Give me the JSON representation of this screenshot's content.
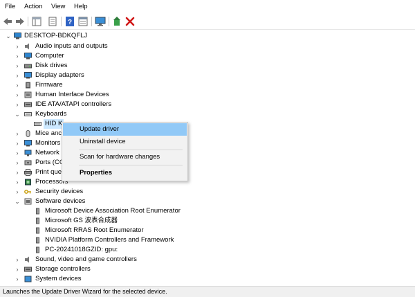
{
  "menu": [
    "File",
    "Action",
    "View",
    "Help"
  ],
  "toolbar_icons": [
    "back-icon",
    "forward-icon",
    "show-hide-tree-icon",
    "properties-icon",
    "help-icon",
    "view-icon",
    "monitor-icon",
    "update-driver-icon",
    "uninstall-icon"
  ],
  "tree": {
    "root": "DESKTOP-BDKQFLJ",
    "items": [
      {
        "label": "Audio inputs and outputs",
        "icon": "speaker-icon",
        "state": "collapsed"
      },
      {
        "label": "Computer",
        "icon": "computer-icon",
        "state": "collapsed"
      },
      {
        "label": "Disk drives",
        "icon": "disk-icon",
        "state": "collapsed"
      },
      {
        "label": "Display adapters",
        "icon": "display-icon",
        "state": "collapsed"
      },
      {
        "label": "Firmware",
        "icon": "chip-icon",
        "state": "collapsed"
      },
      {
        "label": "Human Interface Devices",
        "icon": "hid-icon",
        "state": "collapsed"
      },
      {
        "label": "IDE ATA/ATAPI controllers",
        "icon": "ide-icon",
        "state": "collapsed"
      },
      {
        "label": "Keyboards",
        "icon": "keyboard-icon",
        "state": "expanded"
      },
      {
        "label": "HID K",
        "icon": "keyboard-icon",
        "state": "child-selected"
      },
      {
        "label": "Mice anc",
        "icon": "mouse-icon",
        "state": "collapsed"
      },
      {
        "label": "Monitors",
        "icon": "monitor-icon",
        "state": "collapsed"
      },
      {
        "label": "Network",
        "icon": "network-icon",
        "state": "collapsed"
      },
      {
        "label": "Ports (CC",
        "icon": "port-icon",
        "state": "collapsed"
      },
      {
        "label": "Print que",
        "icon": "printer-icon",
        "state": "collapsed"
      },
      {
        "label": "Processors",
        "icon": "cpu-icon",
        "state": "collapsed"
      },
      {
        "label": "Security devices",
        "icon": "key-icon",
        "state": "collapsed"
      },
      {
        "label": "Software devices",
        "icon": "software-icon",
        "state": "expanded"
      },
      {
        "label": "Microsoft Device Association Root Enumerator",
        "icon": "device-icon",
        "state": "child"
      },
      {
        "label": "Microsoft GS 波表合成器",
        "icon": "device-icon",
        "state": "child"
      },
      {
        "label": "Microsoft RRAS Root Enumerator",
        "icon": "device-icon",
        "state": "child"
      },
      {
        "label": "NVIDIA Platform Controllers and Framework",
        "icon": "device-icon",
        "state": "child"
      },
      {
        "label": "PC-20241018GZID: gpu:",
        "icon": "device-icon",
        "state": "child"
      },
      {
        "label": "Sound, video and game controllers",
        "icon": "sound-icon",
        "state": "collapsed"
      },
      {
        "label": "Storage controllers",
        "icon": "storage-icon",
        "state": "collapsed"
      },
      {
        "label": "System devices",
        "icon": "system-icon",
        "state": "collapsed"
      }
    ]
  },
  "context_menu": {
    "update": "Update driver",
    "uninstall": "Uninstall device",
    "scan": "Scan for hardware changes",
    "properties": "Properties"
  },
  "status": "Launches the Update Driver Wizard for the selected device."
}
